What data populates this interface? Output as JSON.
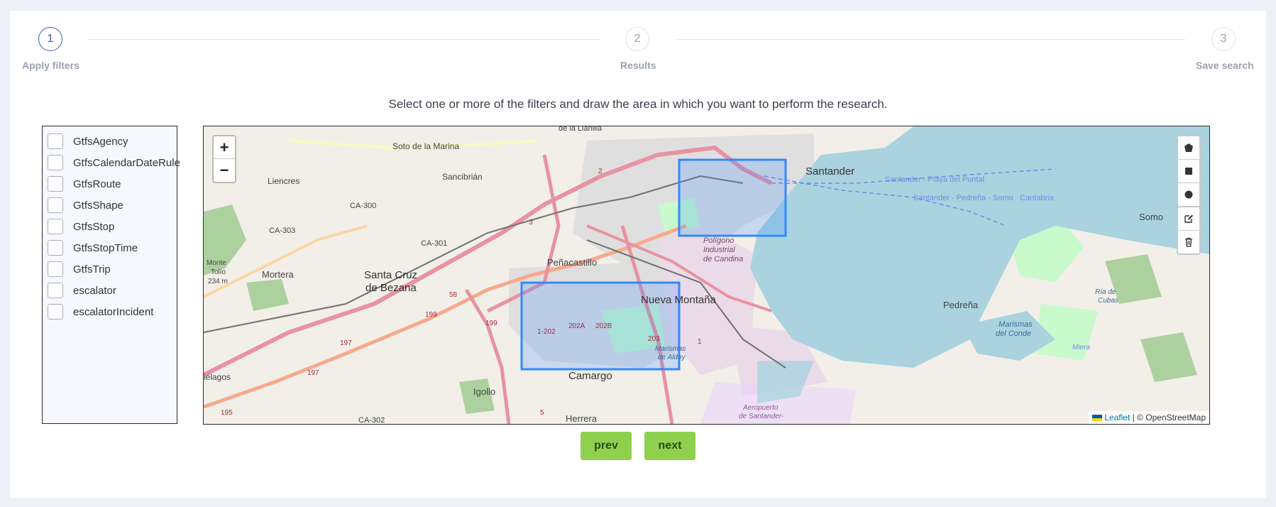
{
  "stepper": {
    "steps": [
      {
        "number": "1",
        "label": "Apply filters",
        "active": true
      },
      {
        "number": "2",
        "label": "Results",
        "active": false
      },
      {
        "number": "3",
        "label": "Save search",
        "active": false
      }
    ]
  },
  "instructions": "Select one or more of the filters and draw the area in which you want to perform the research.",
  "filters": [
    {
      "label": "GtfsAgency",
      "checked": false
    },
    {
      "label": "GtfsCalendarDateRule",
      "checked": false
    },
    {
      "label": "GtfsRoute",
      "checked": false
    },
    {
      "label": "GtfsShape",
      "checked": false
    },
    {
      "label": "GtfsStop",
      "checked": false
    },
    {
      "label": "GtfsStopTime",
      "checked": false
    },
    {
      "label": "GtfsTrip",
      "checked": false
    },
    {
      "label": "escalator",
      "checked": false
    },
    {
      "label": "escalatorIncident",
      "checked": false
    }
  ],
  "map": {
    "zoom_in": "+",
    "zoom_out": "−",
    "draw_tools": [
      "polygon-icon",
      "rectangle-icon",
      "circle-icon"
    ],
    "edit_tools": [
      "edit-icon",
      "trash-icon"
    ],
    "attribution": {
      "leaflet": "Leaflet",
      "separator": " | ",
      "osm": "© OpenStreetMap"
    },
    "labels": {
      "la_llanilla": "de la Llanilla",
      "soto": "Soto de la Marina",
      "sancibrian": "Sancibrián",
      "liencres": "Liencres",
      "ca300": "CA-300",
      "ca303": "CA-303",
      "ca301": "CA-301",
      "ca302": "CA-302",
      "santander": "Santander",
      "playa": "Santander - Playa del Puntal",
      "pedrena": "Santander - Pedreña - Somo",
      "cantabria": "Cantabria",
      "somo": "Somo",
      "poligono1": "Polígono",
      "poligono2": "Industrial",
      "poligono3": "de Candina",
      "penacastillo": "Peñacastillo",
      "monte1": "Monte",
      "monte2": "Tolío",
      "monte3": "234 m",
      "mortera": "Mortera",
      "santacruz1": "Santa Cruz",
      "santacruz2": "de Bezana",
      "nueva_montana": "Nueva Montaña",
      "ria1": "Ría de",
      "ria2": "Cubas",
      "pedrena_town": "Pedreña",
      "marismas1": "Marismas",
      "marismas2": "del Conde",
      "miera": "Miera",
      "marismas_aldoy1": "Marismas",
      "marismas_aldoy2": "de Aldoy",
      "camargo": "Camargo",
      "igollo": "Igollo",
      "herrera": "Herrera",
      "aeropuerto1": "Aeropuerto",
      "aeropuerto2": "de Santander-",
      "cielagos": "iélagos",
      "r2": "2",
      "r3": "3",
      "r58": "58",
      "r199a": "199",
      "r199b": "199",
      "r197a": "197",
      "r197b": "197",
      "r195": "195",
      "r202": "1-202",
      "r202a": "202A",
      "r202b": "202B",
      "r203": "203",
      "r5": "5",
      "r1": "1"
    },
    "selections": [
      {
        "name": "north-rectangle"
      },
      {
        "name": "south-rectangle"
      }
    ]
  },
  "buttons": {
    "prev": "prev",
    "next": "next"
  },
  "colors": {
    "accent": "#3d5ab4",
    "button": "#8fd14f",
    "water": "#aad3df",
    "selection": "#3388ff"
  }
}
